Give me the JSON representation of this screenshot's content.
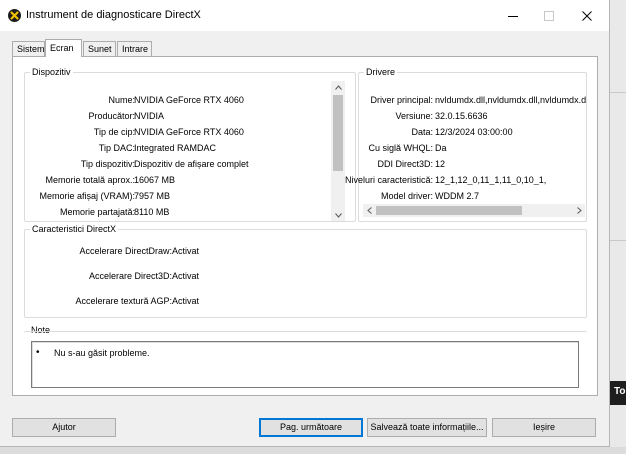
{
  "window": {
    "title": "Instrument de diagnosticare DirectX"
  },
  "tabs": [
    {
      "label": "Sistem"
    },
    {
      "label": "Ecran",
      "active": true
    },
    {
      "label": "Sunet"
    },
    {
      "label": "Intrare"
    }
  ],
  "device": {
    "legend": "Dispozitiv",
    "rows": [
      {
        "label": "Nume:",
        "value": "NVIDIA GeForce RTX 4060"
      },
      {
        "label": "Producător:",
        "value": "NVIDIA"
      },
      {
        "label": "Tip de cip:",
        "value": "NVIDIA GeForce RTX 4060"
      },
      {
        "label": "Tip DAC:",
        "value": "Integrated RAMDAC"
      },
      {
        "label": "Tip dispozitiv:",
        "value": "Dispozitiv de afișare complet"
      },
      {
        "label": "Memorie totală aprox.:",
        "value": "16067 MB"
      },
      {
        "label": "Memorie afișaj (VRAM):",
        "value": "7957 MB"
      },
      {
        "label": "Memorie partajată:",
        "value": "8110 MB"
      }
    ]
  },
  "drivers": {
    "legend": "Drivere",
    "rows": [
      {
        "label": "Driver principal:",
        "value": "nvldumdx.dll,nvldumdx.dll,nvldumdx.d"
      },
      {
        "label": "Versiune:",
        "value": "32.0.15.6636"
      },
      {
        "label": "Data:",
        "value": "12/3/2024 03:00:00"
      },
      {
        "label": "Cu siglă WHQL:",
        "value": "Da"
      },
      {
        "label": "DDI Direct3D:",
        "value": "12"
      },
      {
        "label": "Niveluri caracteristică:",
        "value": "12_1,12_0,11_1,11_0,10_1,"
      },
      {
        "label": "Model driver:",
        "value": "WDDM 2.7"
      }
    ]
  },
  "directx_features": {
    "legend": "Caracteristici DirectX",
    "rows": [
      {
        "label": "Accelerare DirectDraw:",
        "value": "Activat"
      },
      {
        "label": "Accelerare Direct3D:",
        "value": "Activat"
      },
      {
        "label": "Accelerare textură AGP:",
        "value": "Activat"
      }
    ]
  },
  "notes": {
    "legend": "Note",
    "items": [
      "Nu s-au găsit probleme."
    ]
  },
  "buttons": {
    "help": "Ajutor",
    "next_page": "Pag. următoare",
    "save_all": "Salvează toate informațiile...",
    "exit": "Ieșire"
  },
  "background": {
    "dark_tab_text": "To"
  },
  "icons": {
    "app": "directx-icon",
    "minimize": "minimize-icon",
    "maximize": "maximize-icon",
    "close": "close-icon"
  }
}
